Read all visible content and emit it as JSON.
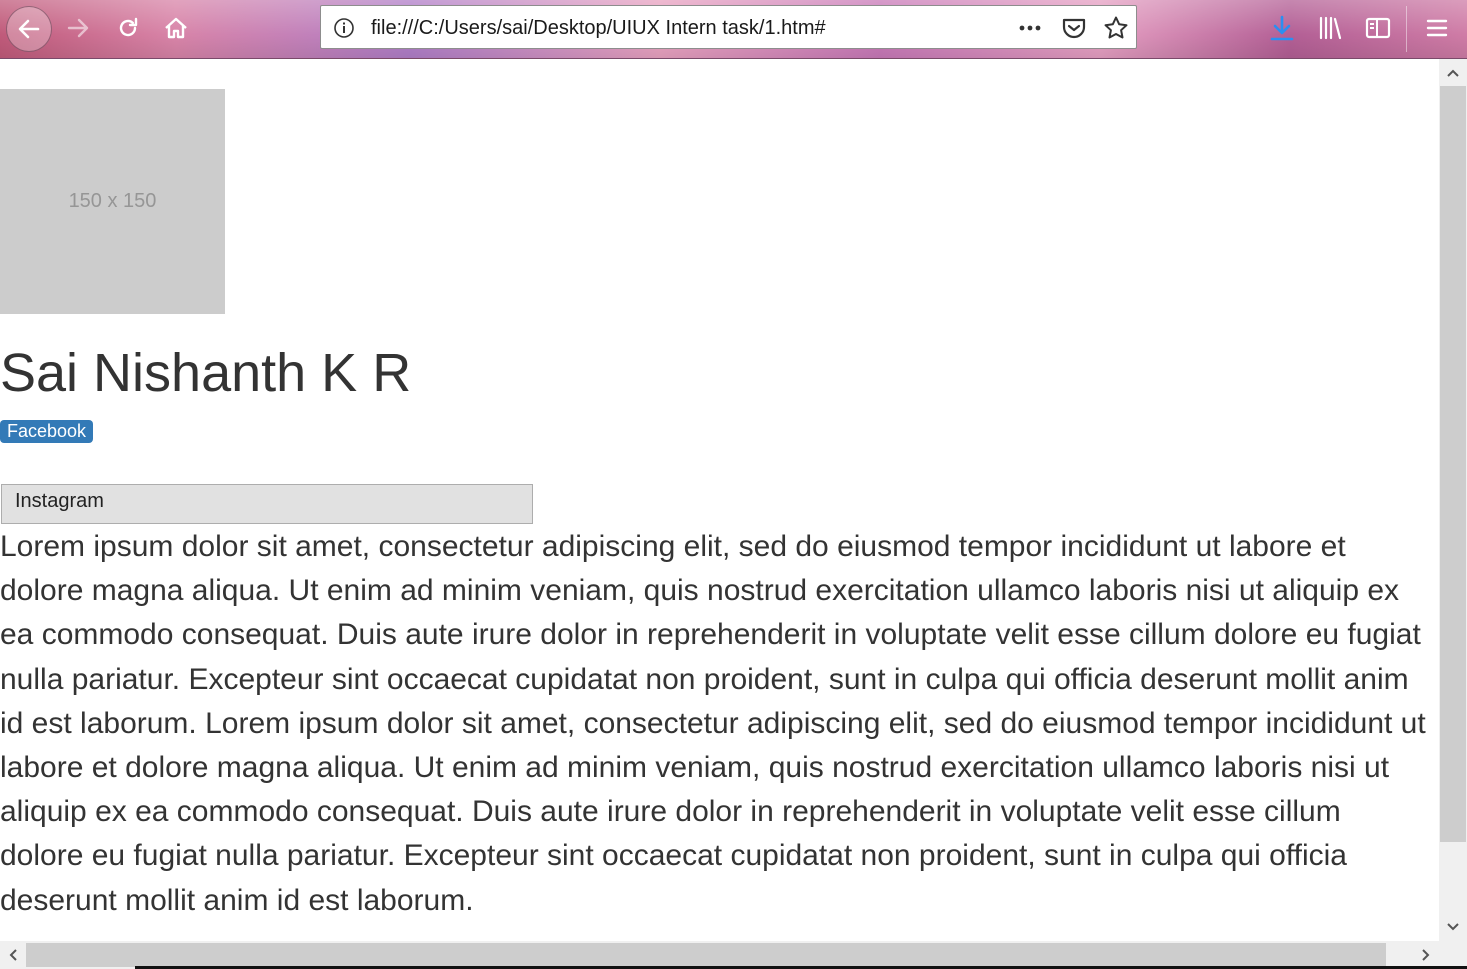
{
  "browser": {
    "url": "file:///C:/Users/sai/Desktop/UIUX Intern task/1.htm#",
    "icons": {
      "back": "back-arrow-icon",
      "forward": "forward-arrow-icon",
      "reload": "reload-icon",
      "home": "home-icon",
      "info": "info-icon",
      "page_actions": "more-dots-icon",
      "pocket": "pocket-icon",
      "bookmark": "star-icon",
      "downloads": "download-icon",
      "library": "library-icon",
      "sidebar": "sidebar-icon",
      "menu": "hamburger-menu-icon"
    },
    "accent_download": "#2a8ff2"
  },
  "page": {
    "image_placeholder": "150 x 150",
    "name": "Sai Nishanth K R",
    "facebook_label": "Facebook",
    "instagram_label": "Instagram",
    "paragraph": "Lorem ipsum dolor sit amet, consectetur adipiscing elit, sed do eiusmod tempor incididunt ut labore et dolore magna aliqua. Ut enim ad minim veniam, quis nostrud exercitation ullamco laboris nisi ut aliquip ex ea commodo consequat. Duis aute irure dolor in reprehenderit in voluptate velit esse cillum dolore eu fugiat nulla pariatur. Excepteur sint occaecat cupidatat non proident, sunt in culpa qui officia deserunt mollit anim id est laborum. Lorem ipsum dolor sit amet, consectetur adipiscing elit, sed do eiusmod tempor incididunt ut labore et dolore magna aliqua. Ut enim ad minim veniam, quis nostrud exercitation ullamco laboris nisi ut aliquip ex ea commodo consequat. Duis aute irure dolor in reprehenderit in voluptate velit esse cillum dolore eu fugiat nulla pariatur. Excepteur sint occaecat cupidatat non proident, sunt in culpa qui officia deserunt mollit anim id est laborum."
  },
  "colors": {
    "badge": "#337ab7",
    "placeholder": "#cccccc",
    "text": "#333333"
  }
}
